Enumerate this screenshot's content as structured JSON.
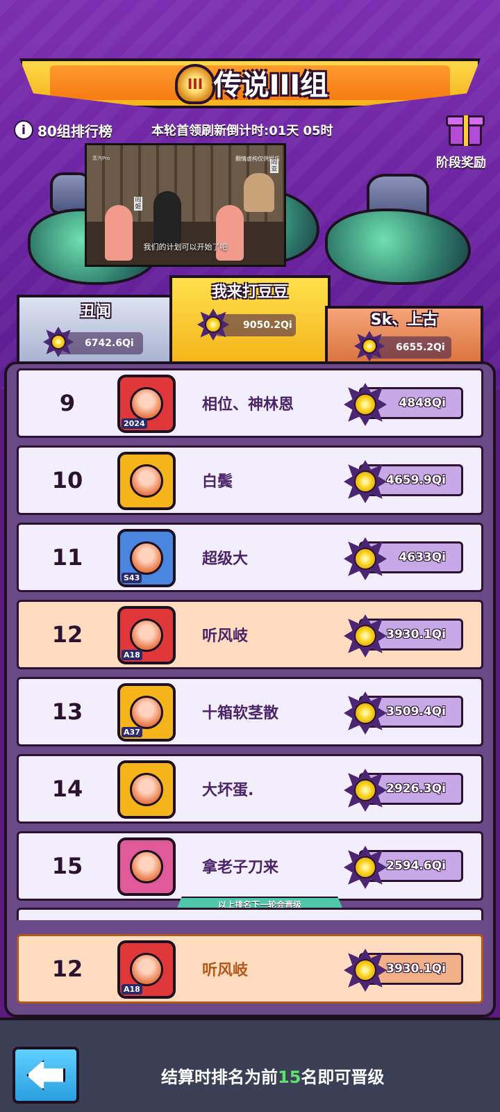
{
  "header": {
    "title": "传说III组",
    "emblem": "III",
    "leaderboard_label": "80组排行榜",
    "countdown": "本轮首领刷新倒计时:01天 05时",
    "stage_reward_label": "阶段奖励"
  },
  "video_overlay": {
    "subtitle": "我们的计划可以开始了吧",
    "watermark": "翻情虚构仅供娱乐",
    "logo_text": "蒸汽Pro",
    "character_label_left": "阎姬",
    "character_label_right": "阎亚"
  },
  "podium": {
    "first": {
      "name": "我来打豆豆",
      "score": "9050.2Qi"
    },
    "second": {
      "name": "丑闻",
      "score": "6742.6Qi"
    },
    "third": {
      "name": "Sk、上古",
      "score": "6655.2Qi"
    }
  },
  "rows": [
    {
      "rank": "9",
      "name": "相位、神林恩",
      "score": "4848Qi",
      "tag": "2024",
      "frame": "#e0383a",
      "me": false
    },
    {
      "rank": "10",
      "name": "白鬓",
      "score": "4659.9Qi",
      "tag": "",
      "frame": "#f4b41a",
      "me": false
    },
    {
      "rank": "11",
      "name": "超级大",
      "score": "4633Qi",
      "tag": "S43",
      "frame": "#4a86e0",
      "me": false
    },
    {
      "rank": "12",
      "name": "听风岐",
      "score": "3930.1Qi",
      "tag": "A18",
      "frame": "#e0383a",
      "me": true
    },
    {
      "rank": "13",
      "name": "十箱软茎散",
      "score": "3509.4Qi",
      "tag": "A37",
      "frame": "#f4b41a",
      "me": false
    },
    {
      "rank": "14",
      "name": "大坏蛋.",
      "score": "2926.3Qi",
      "tag": "",
      "frame": "#f4b41a",
      "me": false
    },
    {
      "rank": "15",
      "name": "拿老子刀来",
      "score": "2594.6Qi",
      "tag": "",
      "frame": "#e05a9a",
      "me": false
    }
  ],
  "promotion_line_label": "以上排名下一轮会晋级",
  "my_rank": {
    "rank": "12",
    "name": "听风岐",
    "score": "3930.1Qi",
    "tag": "A18"
  },
  "footer": {
    "text_before": "结算时排名为前",
    "highlight": "15",
    "text_after": "名即可晋级"
  }
}
